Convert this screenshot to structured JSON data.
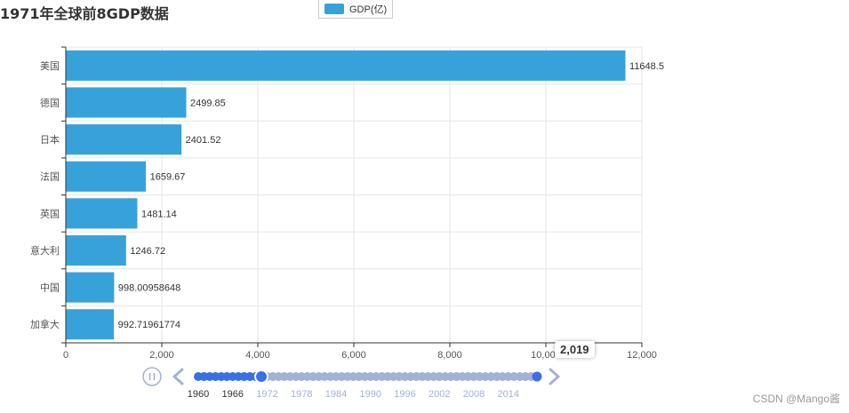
{
  "chart_data": {
    "type": "bar",
    "orientation": "horizontal",
    "title": "1971年全球前8GDP数据",
    "categories": [
      "美国",
      "德国",
      "日本",
      "法国",
      "英国",
      "意大利",
      "中国",
      "加拿大"
    ],
    "series": [
      {
        "name": "GDP(亿)",
        "values": [
          11648.5,
          2499.85,
          2401.52,
          1659.67,
          1481.14,
          1246.72,
          998.00958648,
          992.71961774
        ],
        "labels": [
          "11648.5",
          "2499.85",
          "2401.52",
          "1659.67",
          "1481.14",
          "1246.72",
          "998.00958648",
          "992.71961774"
        ]
      }
    ],
    "xlim": [
      0,
      12000
    ],
    "x_ticks": [
      0,
      2000,
      4000,
      6000,
      8000,
      10000,
      12000
    ],
    "x_tick_labels": [
      "0",
      "2,000",
      "4,000",
      "6,000",
      "8,000",
      "10,000",
      "12,000"
    ],
    "grid": true,
    "legend_position": "top-center",
    "bar_color": "#37a2da"
  },
  "timeline": {
    "play_icon": "pause-icon",
    "prev_icon": "chevron-left-icon",
    "next_icon": "chevron-right-icon",
    "start_year": 1960,
    "end_year": 2019,
    "current_year": 1971,
    "year_labels": [
      "1960",
      "1966",
      "1972",
      "1978",
      "1984",
      "1990",
      "1996",
      "2002",
      "2008",
      "2014"
    ],
    "tooltip": "2,019",
    "active_color": "#3b6fe8",
    "inactive_color": "#a4b1d7"
  },
  "watermark": "CSDN @Mango酱"
}
